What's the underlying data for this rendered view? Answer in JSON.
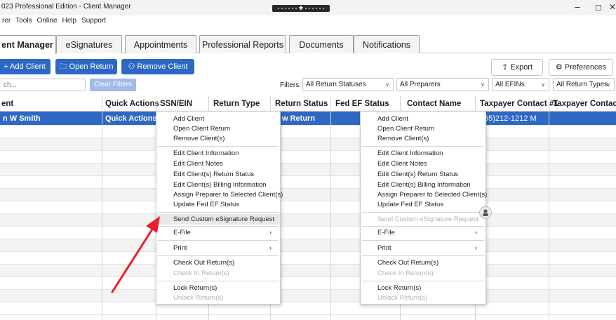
{
  "window": {
    "title": "023 Professional Edition - Client Manager",
    "minimize": "–",
    "maximize": "◻",
    "close": "✕"
  },
  "menubar": [
    "rer",
    "Tools",
    "Online",
    "Help",
    "Support"
  ],
  "tabs": [
    "ent Manager",
    "eSignatures",
    "Appointments",
    "Professional Reports",
    "Documents",
    "Notifications"
  ],
  "toolbar": {
    "add_client": "+ Add Client",
    "open_return": "Open Return",
    "remove_client": "Remove Client",
    "export": "Export",
    "preferences": "Preferences",
    "search_placeholder": "ch...",
    "clear_filters": "Clear Filters",
    "filters_label": "Filters:",
    "filter_status": "All Return Statuses",
    "filter_preparers": "All Preparers",
    "filter_efins": "All EFINs",
    "filter_types": "All Return Types"
  },
  "grid": {
    "columns": [
      "ent",
      "Quick Actions",
      "SSN/EIN",
      "Return Type",
      "Return Status",
      "Fed EF Status",
      "Contact Name",
      "Taxpayer Contact #1",
      "Taxpayer Contact"
    ],
    "selected_row": {
      "client": "n W Smith",
      "quick_actions": "Quick Actions",
      "return_status": "w Return",
      "taxpayer_contact_1": "55)212-1212 M"
    }
  },
  "context_menu_left": {
    "items": [
      {
        "label": "Add Client"
      },
      {
        "label": "Open Client Return"
      },
      {
        "label": "Remove Client(s)"
      },
      {
        "label": "Edit Client Information"
      },
      {
        "label": "Edit Client Notes"
      },
      {
        "label": "Edit Client(s) Return Status"
      },
      {
        "label": "Edit Client(s) Billing Information"
      },
      {
        "label": "Assign Preparer to Selected Client(s)"
      },
      {
        "label": "Update Fed EF Status"
      },
      {
        "label": "Send Custom eSignature Request"
      },
      {
        "label": "E-File"
      },
      {
        "label": "Print"
      },
      {
        "label": "Check Out Return(s)"
      },
      {
        "label": "Check In Return(s)"
      },
      {
        "label": "Lock Return(s)"
      },
      {
        "label": "Unlock Return(s)"
      }
    ],
    "submenu_arrow": "›"
  },
  "context_menu_right": {
    "items": [
      {
        "label": "Add Client"
      },
      {
        "label": "Open Client Return"
      },
      {
        "label": "Remove Client(s)"
      },
      {
        "label": "Edit Client Information"
      },
      {
        "label": "Edit Client Notes"
      },
      {
        "label": "Edit Client(s) Return Status"
      },
      {
        "label": "Edit Client(s) Billing Information"
      },
      {
        "label": "Assign Preparer to Selected Client(s)"
      },
      {
        "label": "Update Fed EF Status"
      },
      {
        "label": "Send Custom eSignature Request"
      },
      {
        "label": "E-File"
      },
      {
        "label": "Print"
      },
      {
        "label": "Check Out Return(s)"
      },
      {
        "label": "Check In Return(s)"
      },
      {
        "label": "Lock Return(s)"
      },
      {
        "label": "Unlock Return(s)"
      }
    ],
    "submenu_arrow": "›"
  },
  "colors": {
    "accent": "#2d69c4",
    "annotation_arrow": "#e8202a"
  },
  "icons": {
    "open_return": "folder-icon",
    "remove_client": "remove-user-icon",
    "export": "export-icon",
    "preferences": "gear-icon",
    "dropdown": "chevron-down-icon",
    "cursor_badge": "person-icon"
  }
}
